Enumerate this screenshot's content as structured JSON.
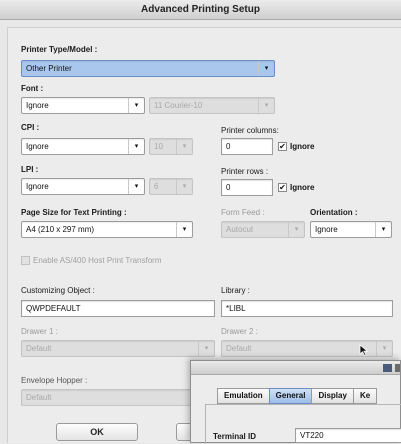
{
  "window": {
    "title": "Advanced Printing Setup"
  },
  "printer_type": {
    "label": "Printer Type/Model :",
    "value": "Other Printer"
  },
  "font": {
    "label": "Font :",
    "value": "Ignore",
    "secondary_value": "11 Courier-10"
  },
  "cpi": {
    "label": "CPI :",
    "value": "Ignore",
    "secondary_value": "10"
  },
  "printer_columns": {
    "label": "Printer columns:",
    "value": "0",
    "ignore_label": "Ignore"
  },
  "lpi": {
    "label": "LPI :",
    "value": "Ignore",
    "secondary_value": "6"
  },
  "printer_rows": {
    "label": "Printer rows :",
    "value": "0",
    "ignore_label": "Ignore"
  },
  "page_size": {
    "label": "Page Size for Text Printing :",
    "value": "A4 (210 x 297 mm)"
  },
  "form_feed": {
    "label": "Form Feed :",
    "value": "Autocut"
  },
  "orientation": {
    "label": "Orientation :",
    "value": "Ignore"
  },
  "host_transform": {
    "label": "Enable AS/400 Host Print Transform"
  },
  "customizing_object": {
    "label": "Customizing Object :",
    "value": "QWPDEFAULT"
  },
  "library": {
    "label": "Library :",
    "value": "*LIBL"
  },
  "drawer1": {
    "label": "Drawer 1 :",
    "value": "Default"
  },
  "drawer2": {
    "label": "Drawer 2 :",
    "value": "Default"
  },
  "envelope_hopper": {
    "label": "Envelope Hopper :",
    "value": "Default"
  },
  "buttons": {
    "ok": "OK",
    "cancel": "Ca"
  },
  "popup": {
    "tabs": [
      "Emulation",
      "General",
      "Display",
      "Ke"
    ],
    "active_tab": "General",
    "terminal_id_label": "Terminal ID",
    "terminal_id_value": "VT220"
  },
  "icons": {
    "arrow": "updown-arrow-icon",
    "check": "checkmark-icon",
    "cursor": "mouse-pointer-icon"
  },
  "colors": {
    "selection": "#a9c7ec",
    "active_tab": "#9cbde8"
  }
}
